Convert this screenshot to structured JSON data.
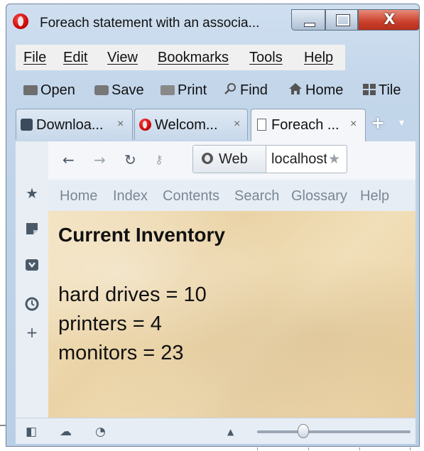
{
  "window": {
    "title": "Foreach statement with an associa...",
    "close_glyph": "X"
  },
  "menubar": {
    "items": [
      {
        "label": "File",
        "underline": "F"
      },
      {
        "label": "Edit",
        "underline": "E"
      },
      {
        "label": "View",
        "underline": "V"
      },
      {
        "label": "Bookmarks",
        "underline": "B"
      },
      {
        "label": "Tools",
        "underline": "T"
      },
      {
        "label": "Help",
        "underline": "H"
      }
    ]
  },
  "toolbar": {
    "open": "Open",
    "save": "Save",
    "print": "Print",
    "find": "Find",
    "home": "Home",
    "tile": "Tile"
  },
  "tabs": [
    {
      "label": "Downloa...",
      "icon": "pocket-icon",
      "active": false
    },
    {
      "label": "Welcom...",
      "icon": "opera-icon",
      "active": false
    },
    {
      "label": "Foreach ...",
      "icon": "page-icon",
      "active": true
    }
  ],
  "navbar": {
    "web_label": "Web",
    "url": "localhost"
  },
  "linkbar": {
    "items": [
      "Home",
      "Index",
      "Contents",
      "Search",
      "Glossary",
      "Help"
    ]
  },
  "content": {
    "heading": "Current Inventory",
    "items": [
      "hard drives = 10",
      "printers = 4",
      "monitors = 23"
    ]
  },
  "statusbar": {
    "zoom_fraction": 0.3
  },
  "colors": {
    "frame": "#c3d6ea",
    "close_button": "#c9402b",
    "page_background": "#ead3a6"
  }
}
